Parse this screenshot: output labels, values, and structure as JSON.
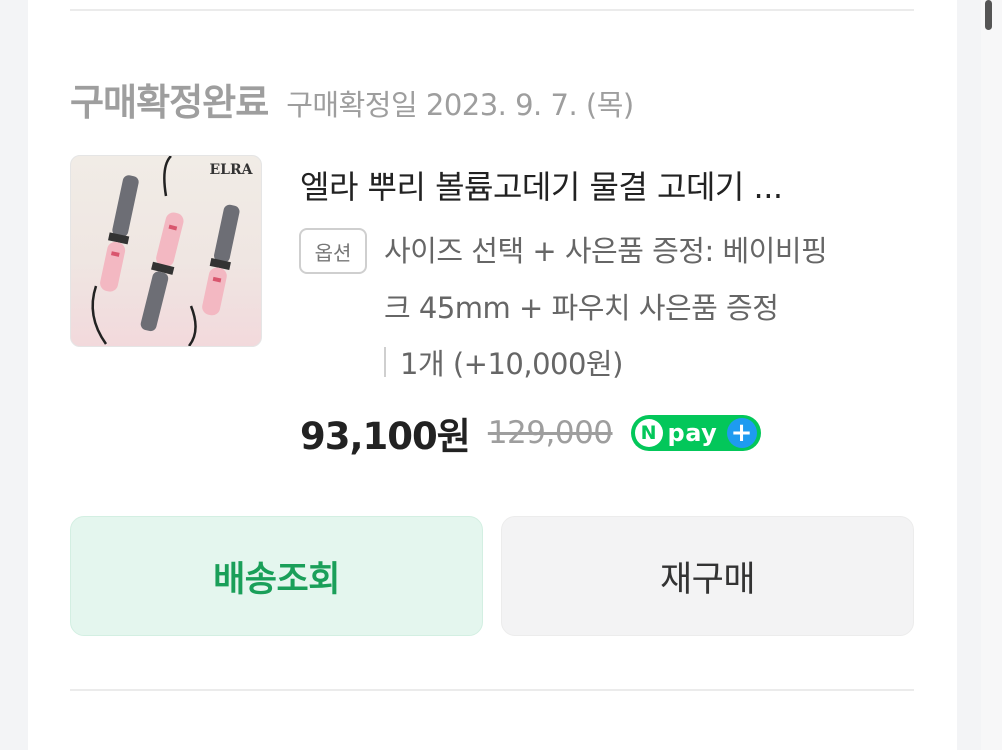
{
  "order": {
    "status": "구매확정완료",
    "confirm_date": "구매확정일 2023. 9. 7. (목)"
  },
  "product": {
    "image_icon": "curling-iron-product-image",
    "brand_on_image": "ELRA",
    "title": "엘라 뿌리 볼륨고데기 물결 고데기 ...",
    "option_badge": "옵션",
    "option_line1": "사이즈 선택 + 사은품 증정: 베이비핑",
    "option_line2": "크 45mm + 파우치 사은품 증정",
    "quantity": "1개 (+10,000원)"
  },
  "price": {
    "current": "93,100원",
    "original": "129,000",
    "npay_n": "N",
    "npay_text": "pay",
    "npay_plus": "+"
  },
  "buttons": {
    "track_label": "배송조회",
    "rebuy_label": "재구매"
  },
  "colors": {
    "accent_green": "#1a9f59",
    "npay_green": "#03c75a",
    "npay_blue": "#1e9bf0"
  }
}
